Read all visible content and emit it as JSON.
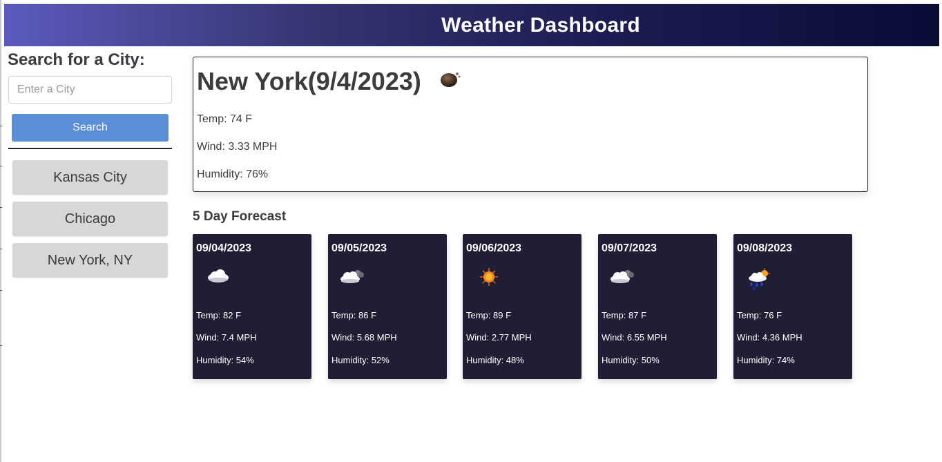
{
  "header": {
    "title": "Weather Dashboard"
  },
  "sidebar": {
    "search_title": "Search for a City:",
    "input_placeholder": "Enter a City",
    "input_value": "",
    "search_button": "Search",
    "history": [
      "Kansas City",
      "Chicago",
      "New York, NY"
    ]
  },
  "current": {
    "title": "New York(9/4/2023)",
    "icon": "dark-cloud-moon-icon",
    "temp": "Temp: 74 F",
    "wind": "Wind: 3.33 MPH",
    "humidity": "Humidity: 76%"
  },
  "forecast": {
    "title": "5 Day Forecast",
    "days": [
      {
        "date": "09/04/2023",
        "icon": "cloud-icon",
        "temp": "Temp: 82 F",
        "wind": "Wind: 7.4 MPH",
        "humidity": "Humidity: 54%"
      },
      {
        "date": "09/05/2023",
        "icon": "broken-clouds-icon",
        "temp": "Temp: 86 F",
        "wind": "Wind: 5.68 MPH",
        "humidity": "Humidity: 52%"
      },
      {
        "date": "09/06/2023",
        "icon": "sun-icon",
        "temp": "Temp: 89 F",
        "wind": "Wind: 2.77 MPH",
        "humidity": "Humidity: 48%"
      },
      {
        "date": "09/07/2023",
        "icon": "broken-clouds-icon",
        "temp": "Temp: 87 F",
        "wind": "Wind: 6.55 MPH",
        "humidity": "Humidity: 50%"
      },
      {
        "date": "09/08/2023",
        "icon": "rain-sun-icon",
        "temp": "Temp: 76 F",
        "wind": "Wind: 4.36 MPH",
        "humidity": "Humidity: 74%"
      }
    ]
  },
  "colors": {
    "header_start": "#5b5bbd",
    "header_end": "#0b0b38",
    "search_button": "#5a8ed6",
    "history_button": "#d8d6d6",
    "card_background": "#1f1e35"
  }
}
